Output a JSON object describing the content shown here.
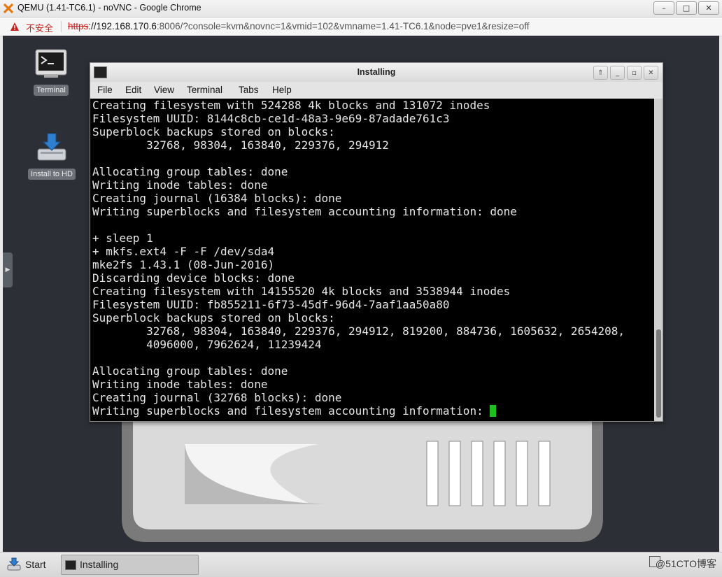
{
  "browser": {
    "title": "QEMU (1.41-TC6.1) - noVNC - Google Chrome",
    "controls": {
      "minimize": "–",
      "maximize": "□",
      "close": "✕"
    },
    "security_label": "不安全",
    "url_scheme": "https",
    "url_host": "://192.168.170.6",
    "url_rest": ":8006/?console=kvm&novnc=1&vmid=102&vmname=1.41-TC6.1&node=pve1&resize=off"
  },
  "desktop": {
    "icons": [
      {
        "label": "Terminal",
        "icon": "terminal-icon"
      },
      {
        "label": "Install to HD",
        "icon": "install-hd-icon"
      }
    ]
  },
  "terminal": {
    "title": "Installing",
    "menu": [
      "File",
      "Edit",
      "View",
      "Terminal",
      "Tabs",
      "Help"
    ],
    "lines": [
      "Creating filesystem with 524288 4k blocks and 131072 inodes",
      "Filesystem UUID: 8144c8cb-ce1d-48a3-9e69-87adade761c3",
      "Superblock backups stored on blocks:",
      "        32768, 98304, 163840, 229376, 294912",
      "",
      "Allocating group tables: done",
      "Writing inode tables: done",
      "Creating journal (16384 blocks): done",
      "Writing superblocks and filesystem accounting information: done",
      "",
      "+ sleep 1",
      "+ mkfs.ext4 -F -F /dev/sda4",
      "mke2fs 1.43.1 (08-Jun-2016)",
      "Discarding device blocks: done",
      "Creating filesystem with 14155520 4k blocks and 3538944 inodes",
      "Filesystem UUID: fb855211-6f73-45df-96d4-7aaf1aa50a80",
      "Superblock backups stored on blocks:",
      "        32768, 98304, 163840, 229376, 294912, 819200, 884736, 1605632, 2654208,",
      "        4096000, 7962624, 11239424",
      "",
      "Allocating group tables: done",
      "Writing inode tables: done",
      "Creating journal (32768 blocks): done",
      "Writing superblocks and filesystem accounting information: "
    ],
    "cursor_color": "#1fbf1f"
  },
  "taskbar": {
    "start_label": "Start",
    "task_label": "Installing",
    "watermark": "@51CTO博客"
  }
}
